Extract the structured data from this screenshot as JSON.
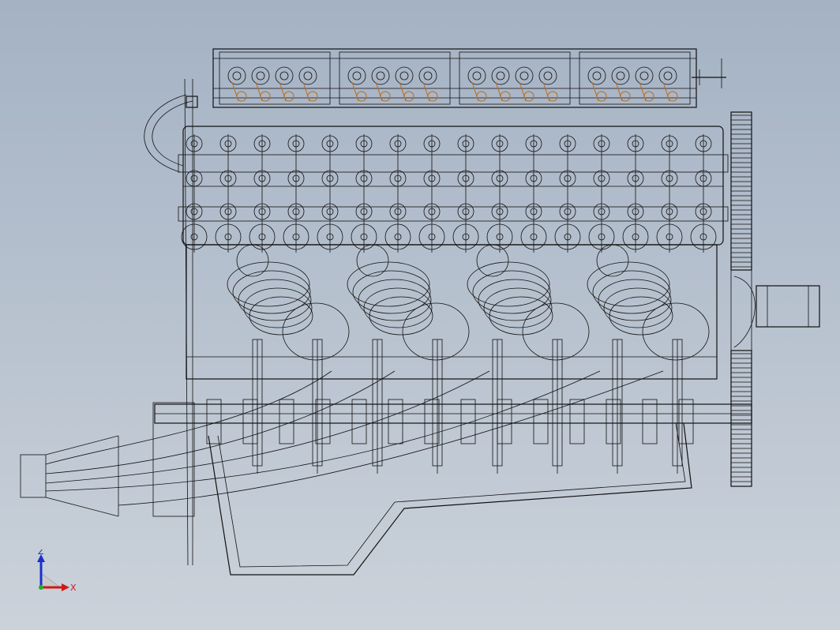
{
  "viewport": {
    "background_top": "#a4b2c4",
    "background_bottom": "#cbd2da",
    "line_color": "#111111",
    "highlight_color": "#b86a1c"
  },
  "drawing": {
    "subject": "engine-block-wireframe",
    "cylinders_visible": 4,
    "camshaft_caps": 4
  },
  "triad": {
    "z_label": "Z",
    "x_label": "X",
    "z_color": "#1a2fd1",
    "x_color": "#d01818",
    "origin_color": "#1db31d"
  }
}
